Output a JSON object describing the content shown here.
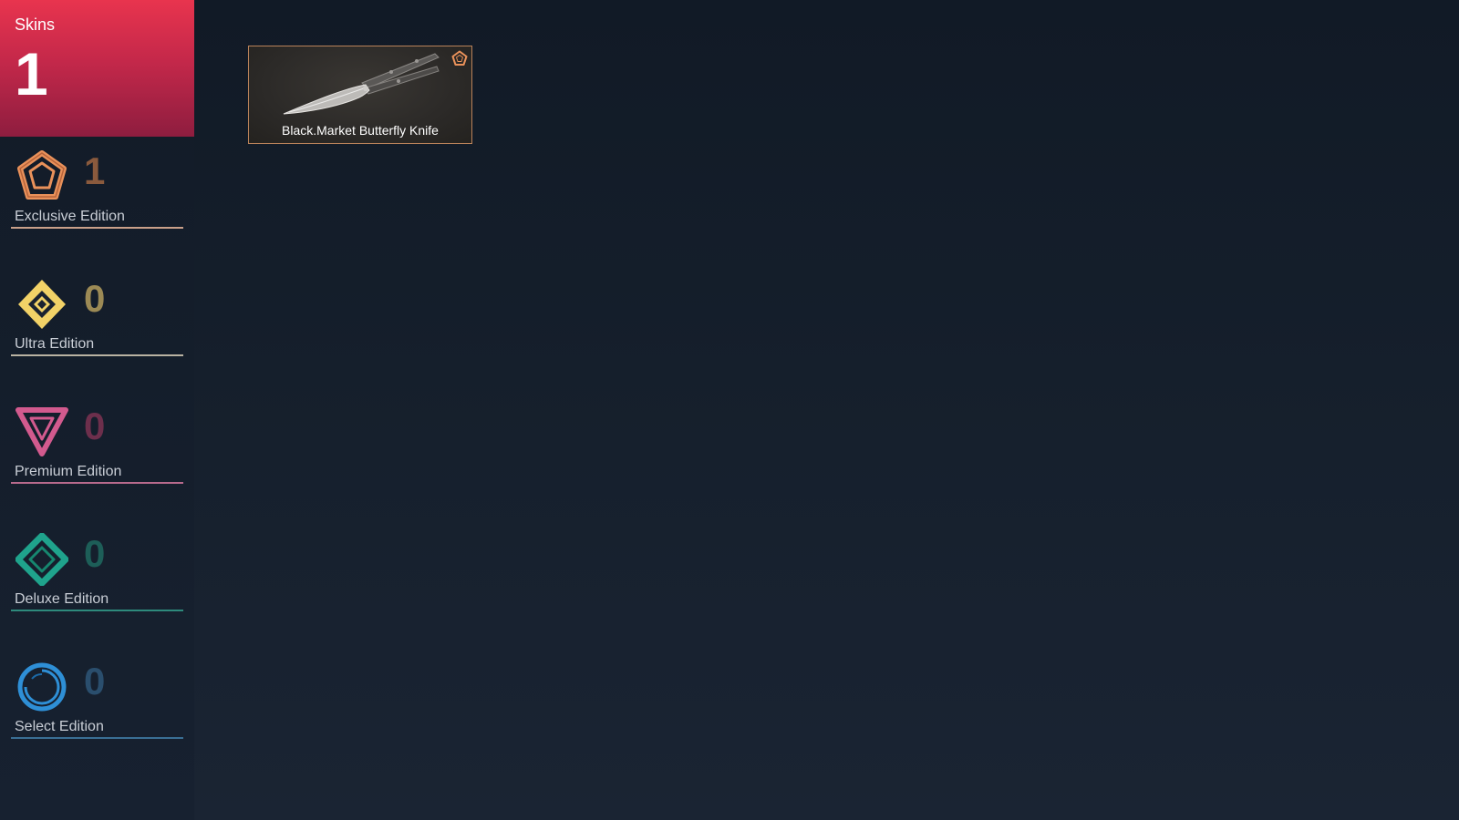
{
  "skins": {
    "label": "Skins",
    "count": "1"
  },
  "tiers": [
    {
      "name": "Exclusive Edition",
      "count": "1",
      "icon": "exclusive-edition-icon",
      "color": "#e9915a",
      "count_color": "#8a5a3d",
      "line_color": "#c9a08a"
    },
    {
      "name": "Ultra Edition",
      "count": "0",
      "icon": "ultra-edition-icon",
      "color": "#f2d267",
      "count_color": "#9c8a55",
      "line_color": "#b9b3a2"
    },
    {
      "name": "Premium Edition",
      "count": "0",
      "icon": "premium-edition-icon",
      "color": "#d25a8e",
      "count_color": "#6d2f4c",
      "line_color": "#b86a8d"
    },
    {
      "name": "Deluxe Edition",
      "count": "0",
      "icon": "deluxe-edition-icon",
      "color": "#1fa38c",
      "count_color": "#1d5e58",
      "line_color": "#2e8a7c"
    },
    {
      "name": "Select Edition",
      "count": "0",
      "icon": "select-edition-icon",
      "color": "#2e8fd6",
      "count_color": "#2a4e6d",
      "line_color": "#3a6f95"
    }
  ],
  "items": [
    {
      "name": "Black.Market Butterfly Knife",
      "tier_icon": "exclusive-edition-icon",
      "border_color": "#b9825a"
    }
  ]
}
